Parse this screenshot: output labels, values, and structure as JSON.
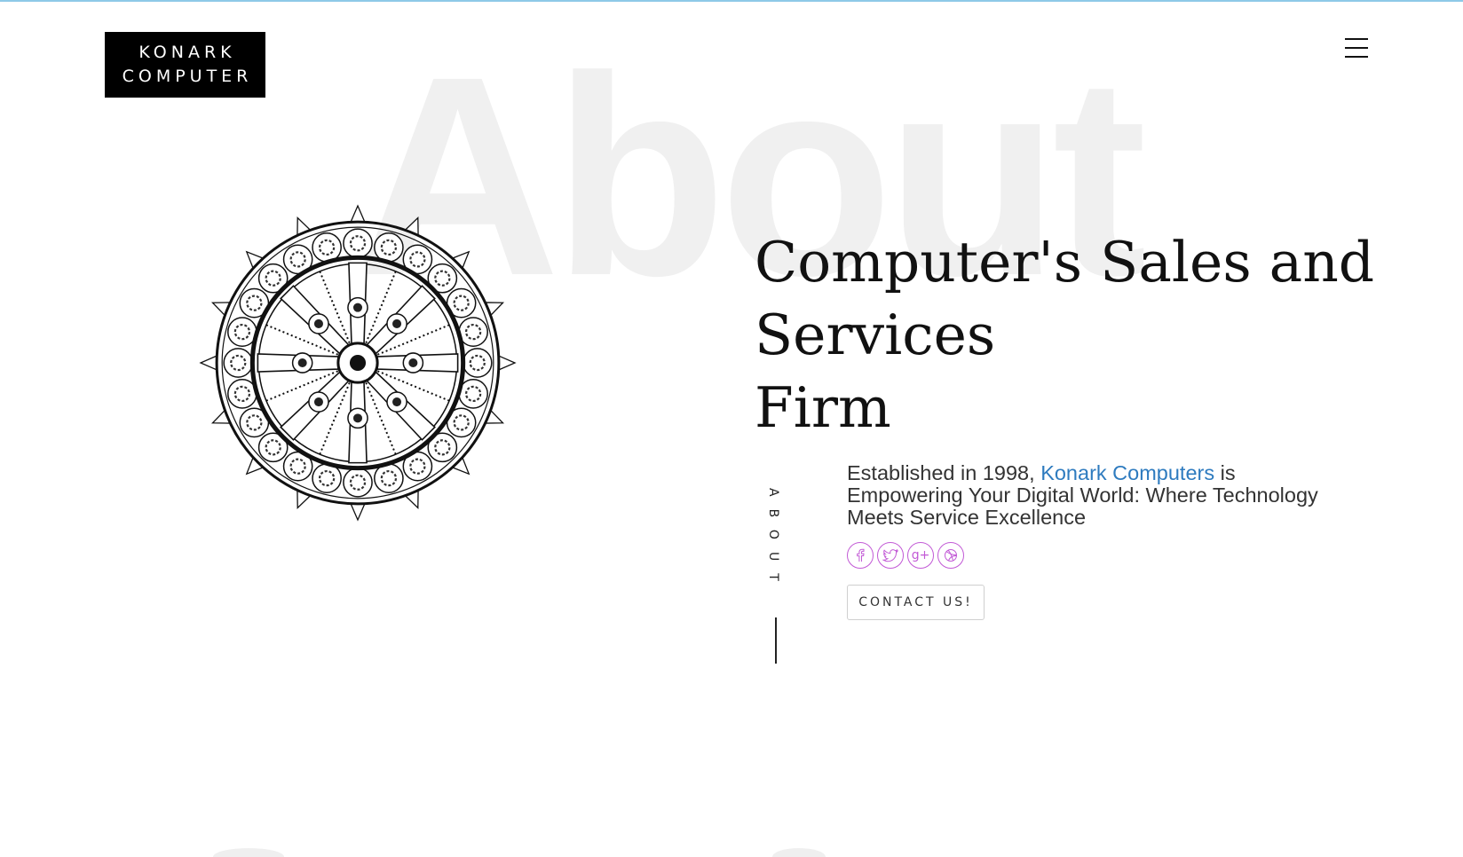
{
  "brand": {
    "line1": "KONARK",
    "line2": "COMPUTER"
  },
  "nav": {
    "menu_icon": "hamburger-menu-icon"
  },
  "hero": {
    "background_word": "About",
    "wheel_image": "konark-wheel-illustration",
    "headline": {
      "line1": "Computer's Sales and",
      "line2": "Services",
      "line3": "Firm"
    },
    "side_label": "ABOUT",
    "description": {
      "before": "Established in 1998, ",
      "link": "Konark Computers",
      "after": " is Empowering Your Digital World: Where Technology Meets Service Excellence"
    },
    "social": [
      {
        "icon": "facebook-icon",
        "glyph": "f"
      },
      {
        "icon": "twitter-icon",
        "glyph": ""
      },
      {
        "icon": "google-plus-icon",
        "glyph": "g+"
      },
      {
        "icon": "dribbble-icon",
        "glyph": ""
      }
    ],
    "cta_label": "CONTACT US!"
  },
  "colors": {
    "accent_link": "#2e7bbf",
    "social": "#c25ad6",
    "top_border": "#8ec9e8",
    "watermark": "#f0f0f0"
  }
}
